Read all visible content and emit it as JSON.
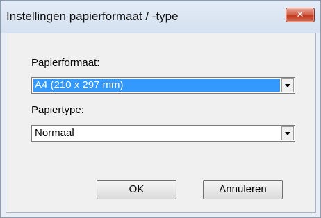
{
  "window": {
    "title": "Instellingen papierformaat / -type",
    "close_glyph": "✕"
  },
  "paper_size": {
    "label": "Papierformaat:",
    "value": "A4 (210 x 297 mm)"
  },
  "paper_type": {
    "label": "Papiertype:",
    "value": "Normaal"
  },
  "buttons": {
    "ok": "OK",
    "cancel": "Annuleren"
  }
}
